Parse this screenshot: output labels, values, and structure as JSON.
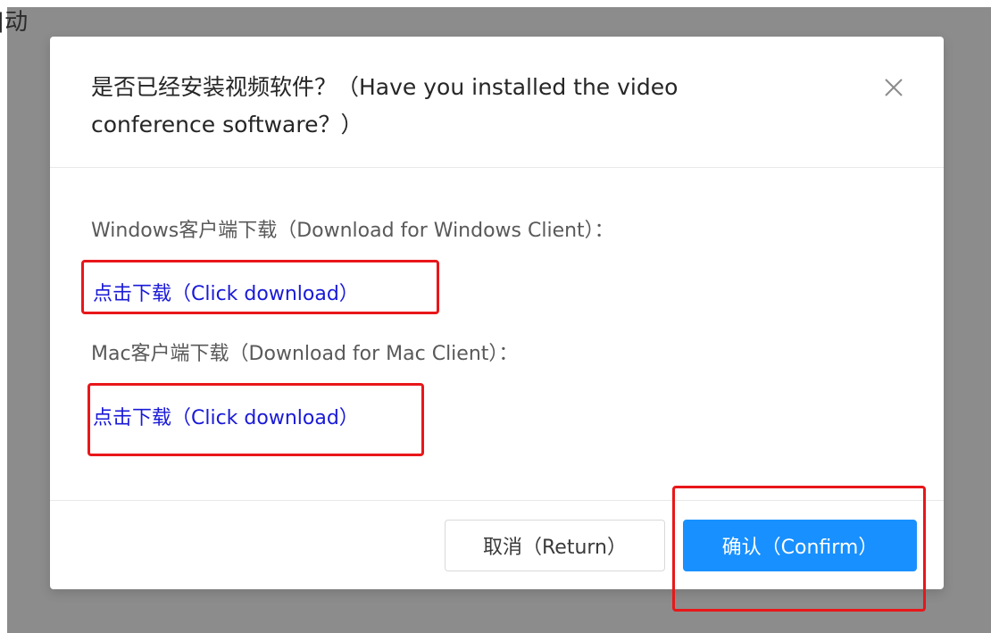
{
  "background": {
    "fragment_text": "]动"
  },
  "modal": {
    "title": "是否已经安装视频软件？（Have you installed the video conference software？）",
    "close_icon": "close-icon",
    "windows": {
      "label": "Windows客户端下载（Download for Windows Client）：",
      "link": "点击下载（Click download）"
    },
    "mac": {
      "label": "Mac客户端下载（Download for Mac Client）：",
      "link": "点击下载（Click download）"
    },
    "footer": {
      "cancel_label": "取消（Return）",
      "confirm_label": "确认（Confirm）"
    }
  },
  "colors": {
    "overlay": "#8c8c8c",
    "link": "#1919d8",
    "primary": "#1890ff",
    "highlight_box": "#e8171a"
  }
}
